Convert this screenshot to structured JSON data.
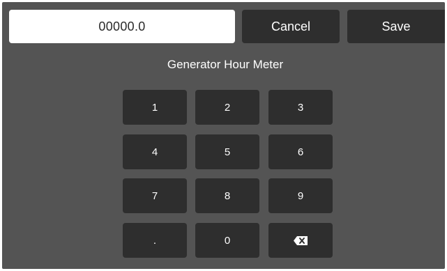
{
  "entry": {
    "value": "00000.0"
  },
  "buttons": {
    "cancel_label": "Cancel",
    "save_label": "Save"
  },
  "title": "Generator Hour Meter",
  "keypad": {
    "k1": "1",
    "k2": "2",
    "k3": "3",
    "k4": "4",
    "k5": "5",
    "k6": "6",
    "k7": "7",
    "k8": "8",
    "k9": "9",
    "kdot": ".",
    "k0": "0",
    "backspace_icon": "backspace-icon"
  },
  "colors": {
    "background": "#545454",
    "button": "#2e2e2e",
    "field": "#ffffff",
    "text": "#ffffff"
  }
}
